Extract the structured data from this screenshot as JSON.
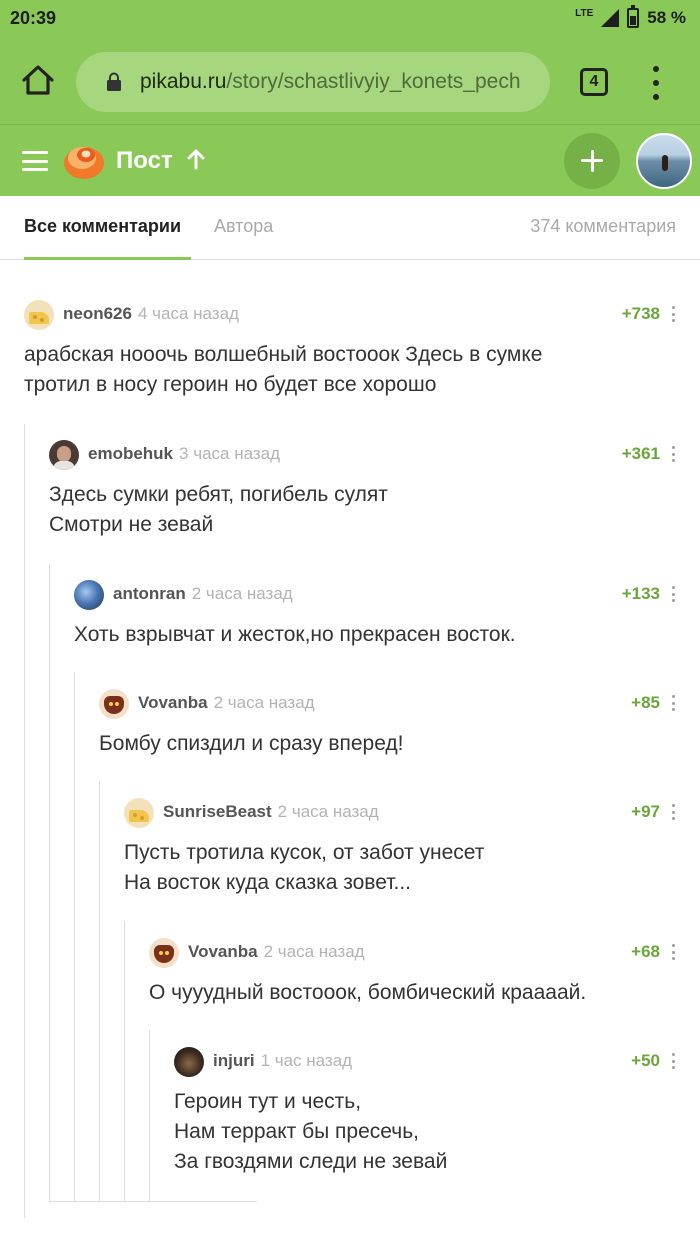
{
  "status_bar": {
    "time": "20:39",
    "network": "LTE",
    "battery": "58 %"
  },
  "browser": {
    "url_domain": "pikabu.ru",
    "url_path": "/story/schastlivyiy_konets_pech",
    "tab_count": "4",
    "home_icon": "home-icon",
    "lock_icon": "lock-icon",
    "menu_icon": "more-vertical-icon"
  },
  "header": {
    "title": "Пост",
    "logo_icon": "pikabu-logo-icon",
    "accent": "#8ac858"
  },
  "tabs": {
    "all_label": "Все комментарии",
    "author_label": "Автора",
    "count_label": "374 комментария"
  },
  "comments": [
    {
      "author": "neon626",
      "time": "4 часа назад",
      "rating": "+738",
      "avatar": "cheese-avatar",
      "text": "арабская нооочь волшебный востооок Здесь в сумке\nтротил в носу героин но будет все хорошо"
    },
    {
      "author": "emobehuk",
      "time": "3 часа назад",
      "rating": "+361",
      "avatar": "photo-avatar",
      "text": "Здесь сумки ребят, погибель сулят\nСмотри не зевай"
    },
    {
      "author": "antonran",
      "time": "2 часа назад",
      "rating": "+133",
      "avatar": "blue-avatar",
      "text": "Хоть взрывчат и жесток,но прекрасен восток."
    },
    {
      "author": "Vovanba",
      "time": "2 часа назад",
      "rating": "+85",
      "avatar": "cat-avatar",
      "text": "Бомбу спиздил и сразу вперед!"
    },
    {
      "author": "SunriseBeast",
      "time": "2 часа назад",
      "rating": "+97",
      "avatar": "cheese-avatar",
      "text": "Пусть тротила кусок, от забот унесет\nНа восток куда сказка зовет..."
    },
    {
      "author": "Vovanba",
      "time": "2 часа назад",
      "rating": "+68",
      "avatar": "cat-avatar",
      "text": "О чууудный востооок, бомбический краааай."
    },
    {
      "author": "injuri",
      "time": "1 час назад",
      "rating": "+50",
      "avatar": "dark-avatar",
      "text": "Героин тут и честь,\nНам терракт бы пресечь,\nЗа гвоздями следи не зевай"
    }
  ]
}
